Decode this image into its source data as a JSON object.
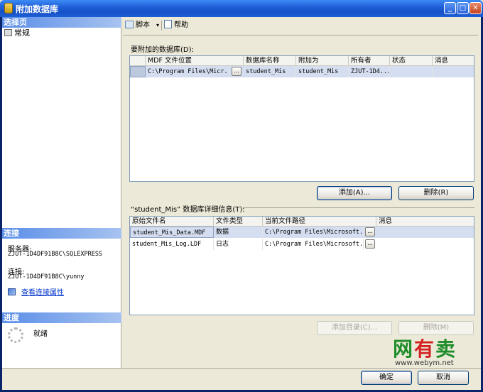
{
  "window": {
    "title": "附加数据库",
    "min_icon": "minimize-icon",
    "max_icon": "maximize-icon",
    "close_icon": "close-icon"
  },
  "left_panel": {
    "select_page_header": "选择页",
    "pages": [
      {
        "label": "常规",
        "icon": "page-icon"
      }
    ],
    "connection_header": "连接",
    "server_label": "服务器:",
    "server_value": "ZJUT-1D4DF91B8C\\SQLEXPRESS",
    "connection_label": "连接:",
    "connection_value": "ZJUT-1D4DF91B8C\\yunny",
    "view_conn_link": "查看连接属性",
    "progress_header": "进度",
    "progress_status": "就绪"
  },
  "toolbar": {
    "script_label": "脚本",
    "dropdown_glyph": "▾",
    "help_label": "帮助"
  },
  "databases": {
    "label": "要附加的数据库(D):",
    "columns": [
      "MDF 文件位置",
      "数据库名称",
      "附加为",
      "所有者",
      "状态",
      "消息"
    ],
    "rows": [
      {
        "mdf": "C:\\Program Files\\Micr...",
        "ellipsis": "...",
        "db_name": "student_Mis",
        "attach_as": "student_Mis",
        "owner": "ZJUT-1D4...",
        "status": "",
        "message": ""
      }
    ],
    "add_button": "添加(A)...",
    "remove_button": "删除(R)"
  },
  "details": {
    "label": "“student_Mis” 数据库详细信息(T):",
    "columns": [
      "原始文件名",
      "文件类型",
      "当前文件路径",
      "消息"
    ],
    "rows": [
      {
        "file": "student_Mis_Data.MDF",
        "type": "数据",
        "path": "C:\\Program Files\\Microsoft...",
        "ellipsis": "...",
        "message": ""
      },
      {
        "file": "student_Mis_Log.LDF",
        "type": "日志",
        "path": "C:\\Program Files\\Microsoft...",
        "ellipsis": "...",
        "message": ""
      }
    ],
    "add_catalog_button": "添加目录(C)...",
    "remove_button": "删除(M)"
  },
  "footer": {
    "ok_button": "确定",
    "cancel_button": "取消"
  },
  "watermark": {
    "chars_a": "网",
    "chars_b": "有",
    "chars_c": "卖",
    "url": "www.webym.net"
  }
}
